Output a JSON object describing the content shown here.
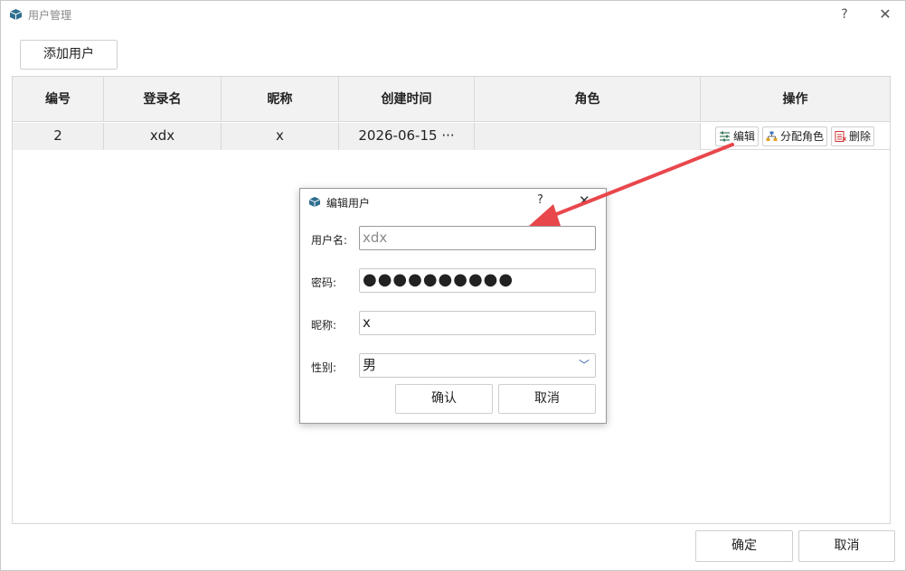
{
  "window": {
    "title": "用户管理",
    "help": "?",
    "close": "✕"
  },
  "toolbar": {
    "add_user": "添加用户"
  },
  "table": {
    "headers": [
      "编号",
      "登录名",
      "昵称",
      "创建时间",
      "角色",
      "操作"
    ],
    "rows": [
      {
        "id": "2",
        "login": "xdx",
        "nickname": "x",
        "created": "2026-06-15 ···",
        "role": ""
      }
    ],
    "actions": {
      "edit": "编辑",
      "assign_role": "分配角色",
      "delete": "删除"
    }
  },
  "footer": {
    "ok": "确定",
    "cancel": "取消"
  },
  "dialog": {
    "title": "编辑用户",
    "help": "?",
    "close": "✕",
    "username_label": "用户名:",
    "username_placeholder": "xdx",
    "password_label": "密码:",
    "password_value": "●●●●●●●●●●",
    "nickname_label": "昵称:",
    "nickname_value": "x",
    "gender_label": "性别:",
    "gender_value": "男",
    "ok": "确认",
    "cancel": "取消"
  },
  "colors": {
    "annotation_arrow": "#e8474c",
    "header_bg": "#f2f2f2",
    "chevron": "#2a5aa8"
  }
}
